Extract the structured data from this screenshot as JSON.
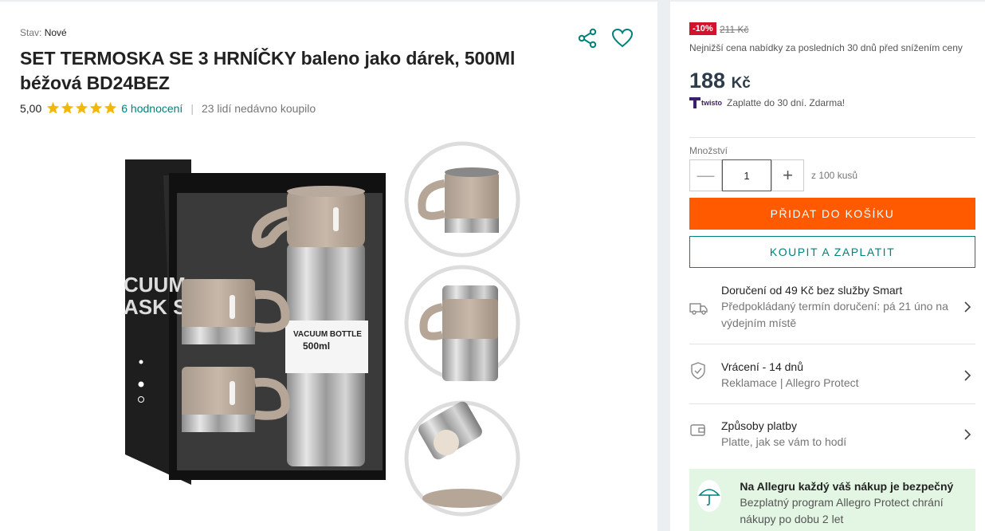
{
  "product": {
    "condition_label": "Stav:",
    "condition_value": "Nové",
    "title": "SET TERMOSKA SE 3 HRNÍČKY baleno jako dárek, 500Ml béžová BD24BEZ",
    "rating_score": "5,00",
    "rating_count_link": "6 hodnocení",
    "recently_bought": "23 lidí nedávno koupilo",
    "stars_filled": 5,
    "image_text_line1": "VACUUM BOTTLE",
    "image_text_line2": "500ml",
    "box_text": "CUUM\nASK S"
  },
  "pricing": {
    "discount_badge": "-10%",
    "old_price": "211 Kč",
    "lowest_price_note": "Nejnižší cena nabídky za posledních 30 dnů před snížením ceny",
    "price_value": "188",
    "price_currency": "Kč",
    "twisto_brand": "twisto",
    "twisto_text": "Zaplatte do 30 dní. Zdarma!"
  },
  "quantity": {
    "label": "Množství",
    "value": "1",
    "max_text": "z 100 kusů"
  },
  "actions": {
    "add_to_cart": "PŘIDAT DO KOŠÍKU",
    "buy_now": "KOUPIT A ZAPLATIT"
  },
  "info_rows": [
    {
      "title": "Doručení od 49 Kč bez služby Smart",
      "subtitle": "Předpokládaný termín doručení: pá 21 úno na výdejním místě"
    },
    {
      "title": "Vrácení - 14 dnů",
      "subtitle": "Reklamace | Allegro Protect"
    },
    {
      "title": "Způsoby platby",
      "subtitle": "Platte, jak se vám to hodí"
    }
  ],
  "protect": {
    "title": "Na Allegru každý váš nákup je bezpečný",
    "subtitle": "Bezplatný program Allegro Protect chrání nákupy po dobu 2 let"
  },
  "colors": {
    "accent_teal": "#00817d",
    "cta_orange": "#ff5a00",
    "discount_red": "#d3122d",
    "star_gold": "#f5b800",
    "protect_bg": "#e3f5e3"
  },
  "icons": [
    "share-icon",
    "heart-icon",
    "star-icon",
    "twisto-logo-icon",
    "minus-icon",
    "plus-icon",
    "truck-icon",
    "shield-icon",
    "wallet-icon",
    "chevron-right-icon",
    "umbrella-icon"
  ]
}
